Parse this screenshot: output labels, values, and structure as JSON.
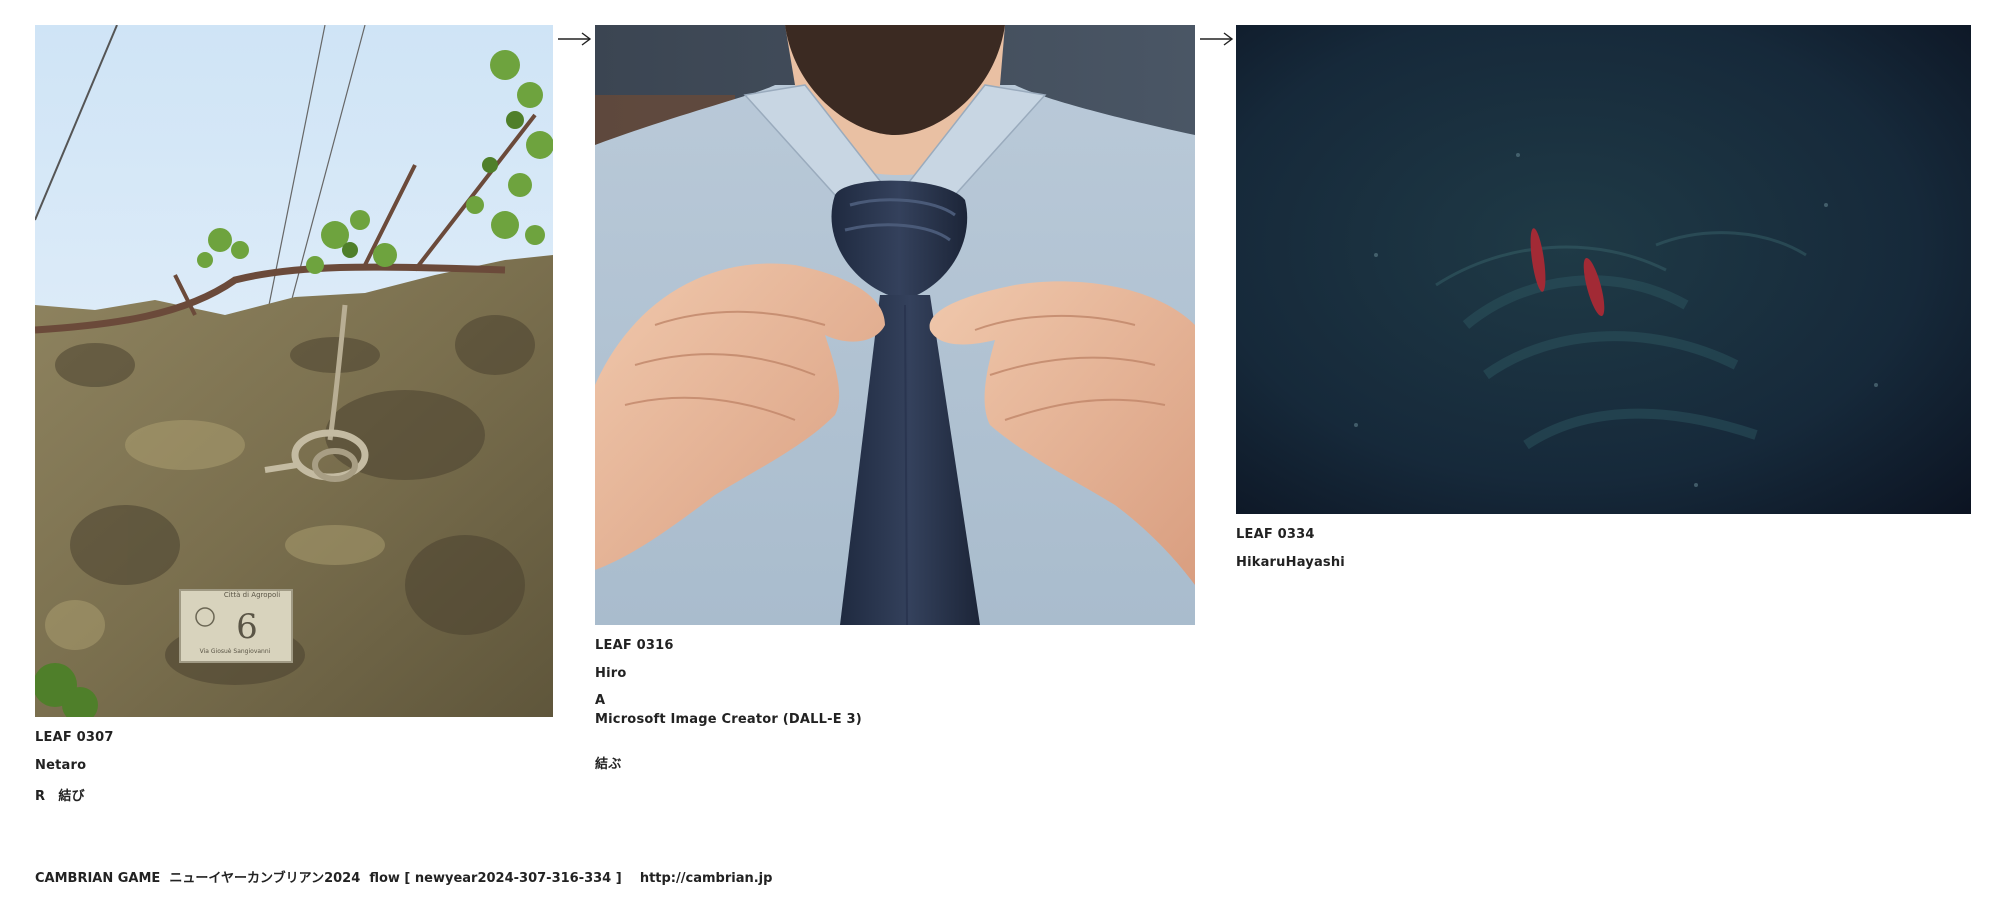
{
  "leaves": [
    {
      "id": "LEAF 0307",
      "author": "Netaro",
      "note": "R　結び",
      "image": "photo-wall-rope-knot"
    },
    {
      "id": "LEAF 0316",
      "author": "Hiro",
      "line1": "A",
      "line2": "Microsoft Image Creator (DALL-E 3)",
      "line3": "結ぶ",
      "image": "photo-tie-knot"
    },
    {
      "id": "LEAF 0334",
      "author": "HikaruHayashi",
      "image": "photo-dark-water-fish"
    }
  ],
  "arrows": [
    "arrow-right-icon",
    "arrow-right-icon"
  ],
  "footer": {
    "game": "CAMBRIAN GAME",
    "event": "ニューイヤーカンブリアン2024",
    "flow": "flow [ newyear2024-307-316-334 ]",
    "url": "http://cambrian.jp"
  },
  "colors": {
    "text": "#222222",
    "background": "#ffffff"
  }
}
